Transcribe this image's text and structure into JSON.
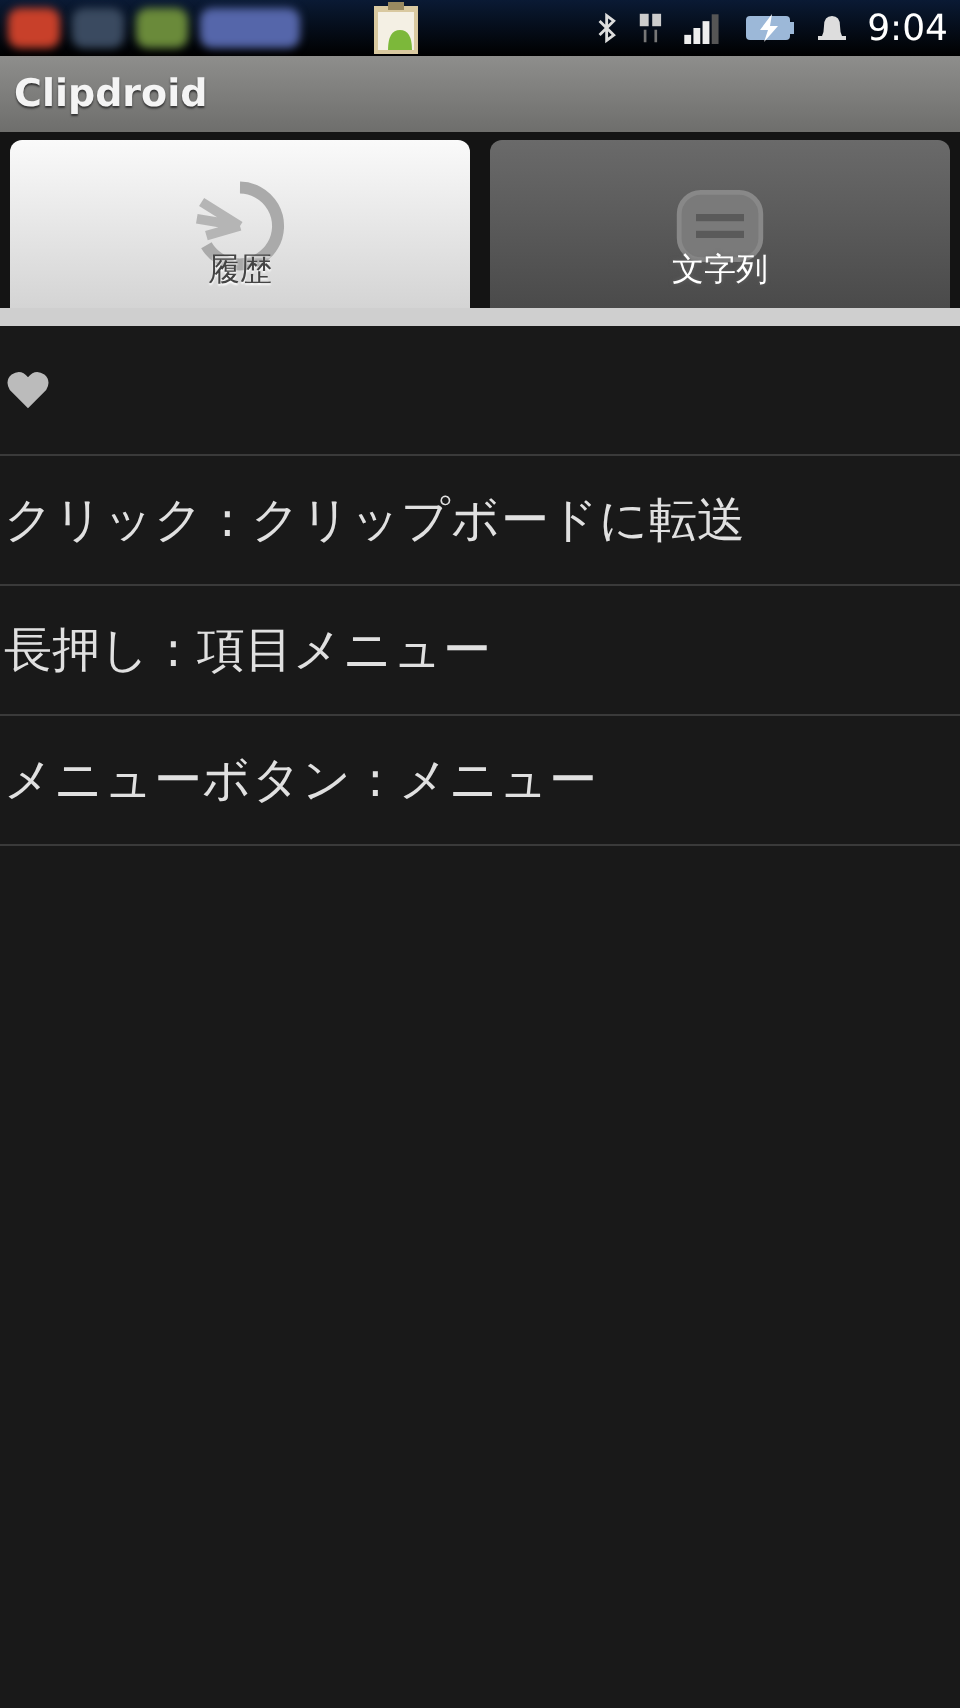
{
  "status_bar": {
    "time": "9:04"
  },
  "app_bar": {
    "title": "Clipdroid"
  },
  "tabs": [
    {
      "label": "履歴",
      "kind": "history",
      "selected": true
    },
    {
      "label": "文字列",
      "kind": "list",
      "selected": false
    }
  ],
  "items": [
    {
      "kind": "heart"
    },
    {
      "kind": "text",
      "text": "クリック : クリップボードに転送"
    },
    {
      "kind": "text",
      "text": "長押し : 項目メニュー"
    },
    {
      "kind": "text",
      "text": "メニューボタン : メニュー"
    }
  ]
}
